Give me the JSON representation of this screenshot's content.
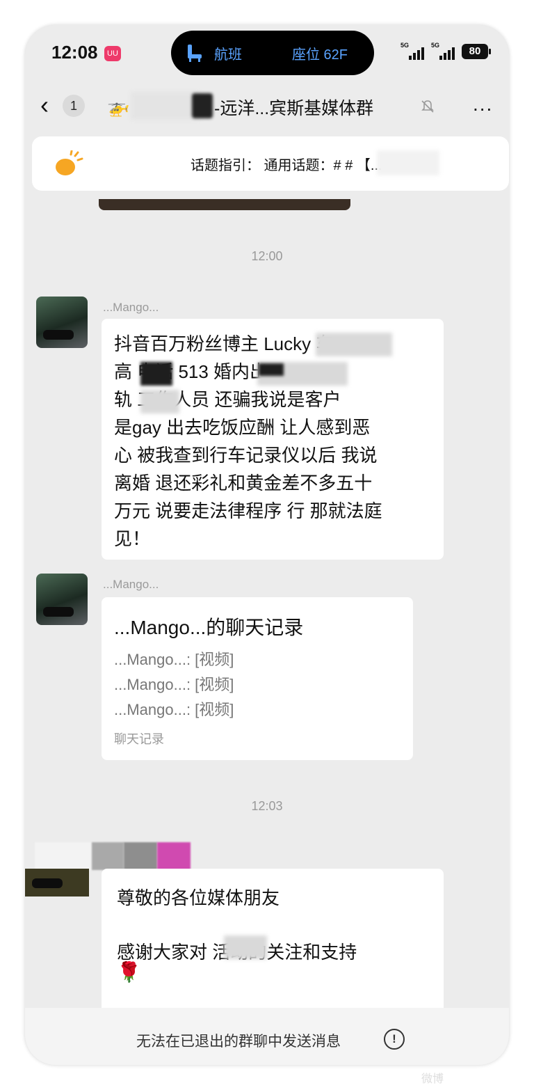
{
  "status_bar": {
    "time": "12:08",
    "app_badge": "UU",
    "flight_label": "航班",
    "seat_label": "座位 62F",
    "signal_1": "5G",
    "signal_2": "5G",
    "battery": "80"
  },
  "nav": {
    "back_icon": "chevron-left-icon",
    "unread_count": "1",
    "group_icon": "helicopter-emoji-icon",
    "title": "-远洋...宾斯基媒体群",
    "mute_icon": "bell-off-icon",
    "more_label": "..."
  },
  "topic_banner": {
    "icon": "lightbulb-icon",
    "text": "话题指引：  通用话题：#          # 【..."
  },
  "messages": [
    {
      "timestamp": "12:00",
      "sender": "...Mango...",
      "lines": [
        "抖音百万粉丝博主 Lucky     车",
        "高      电话               513 婚内出",
        "轨      工作人员 还骗我说是客户",
        "是gay 出去吃饭应酬 让人感到恶",
        "心 被我查到行车记录仪以后 我说",
        "离婚 退还彩礼和黄金差不多五十",
        "万元 说要走法律程序 行 那就法庭",
        "见！"
      ]
    },
    {
      "sender": "...Mango...",
      "record_title": "...Mango...的聊天记录",
      "record_lines": [
        "...Mango...: [视频]",
        "...Mango...: [视频]",
        "...Mango...: [视频]"
      ],
      "record_footer": "聊天记录"
    },
    {
      "timestamp": "12:03",
      "lines": [
        "尊敬的各位媒体朋友",
        "感谢大家对      活动的关注和支持"
      ],
      "emoji": "🌹"
    }
  ],
  "bottom_bar": {
    "text": "无法在已退出的群聊中发送消息",
    "icon": "info-circle-icon",
    "icon_glyph": "!"
  },
  "watermark": "微博"
}
